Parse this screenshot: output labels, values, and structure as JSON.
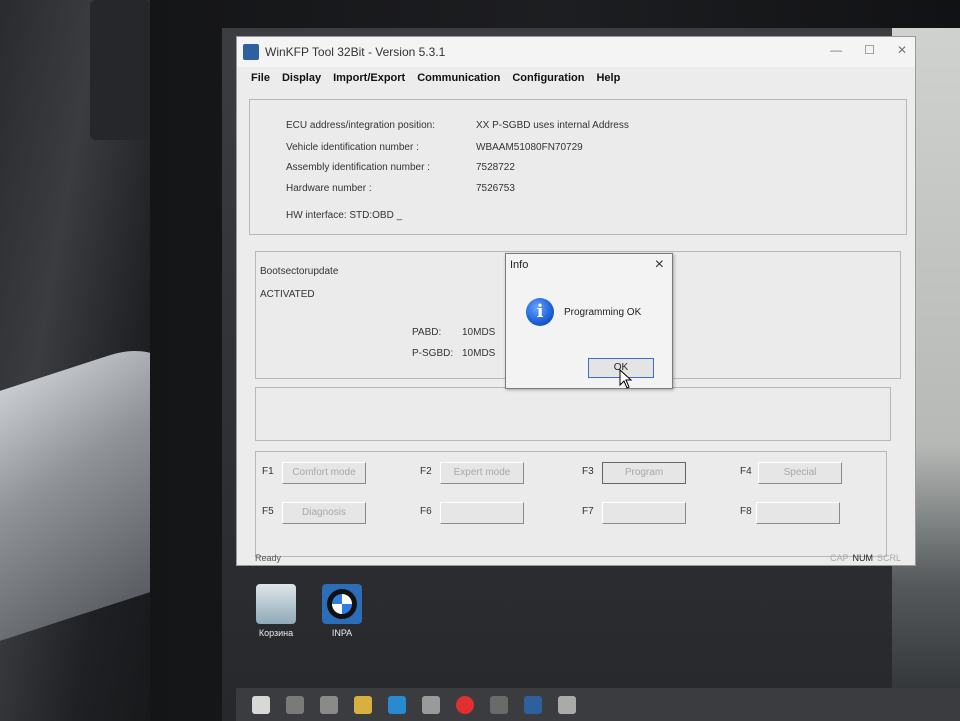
{
  "window": {
    "title": "WinKFP Tool 32Bit - Version 5.3.1"
  },
  "menu": [
    {
      "label": "File"
    },
    {
      "label": "Display"
    },
    {
      "label": "Import/Export"
    },
    {
      "label": "Communication"
    },
    {
      "label": "Configuration"
    },
    {
      "label": "Help"
    }
  ],
  "ecu_info": {
    "ecu_address_label": "ECU address/integration position:",
    "ecu_address_value": "XX  P-SGBD uses internal Address",
    "vin_label": "Vehicle identification number :",
    "vin_value": "WBAAM51080FN70729",
    "assembly_label": "Assembly identification number :",
    "assembly_value": "7528722",
    "hardware_label": "Hardware number :",
    "hardware_value": "7526753",
    "hw_interface": "HW interface:  STD:OBD _"
  },
  "status": {
    "bootsector": "Bootsectorupdate",
    "activated": "ACTIVATED",
    "pabd_label": "PABD:",
    "pabd_value": "10MDS",
    "psgbd_label": "P-SGBD:",
    "psgbd_value": "10MDS"
  },
  "fkeys": [
    {
      "key": "F1",
      "label": "Comfort mode"
    },
    {
      "key": "F2",
      "label": "Expert mode"
    },
    {
      "key": "F3",
      "label": "Program"
    },
    {
      "key": "F4",
      "label": "Special"
    },
    {
      "key": "F5",
      "label": "Diagnosis"
    },
    {
      "key": "F6",
      "label": ""
    },
    {
      "key": "F7",
      "label": ""
    },
    {
      "key": "F8",
      "label": ""
    }
  ],
  "statusbar": {
    "text": "Ready",
    "cap": "CAP",
    "num": "NUM",
    "scrl": "SCRL"
  },
  "dialog": {
    "title": "Info",
    "message": "Programming OK",
    "ok_label": "OK",
    "icon": "info-icon"
  },
  "desktop_icons": [
    {
      "label": "Корзина",
      "icon": "recycle-bin-icon"
    },
    {
      "label": "INPA",
      "icon": "bmw-icon"
    }
  ],
  "colors": {
    "window_bg": "#ececec",
    "info_icon": "#1b5fd6",
    "ok_border": "#3a6fd0"
  }
}
